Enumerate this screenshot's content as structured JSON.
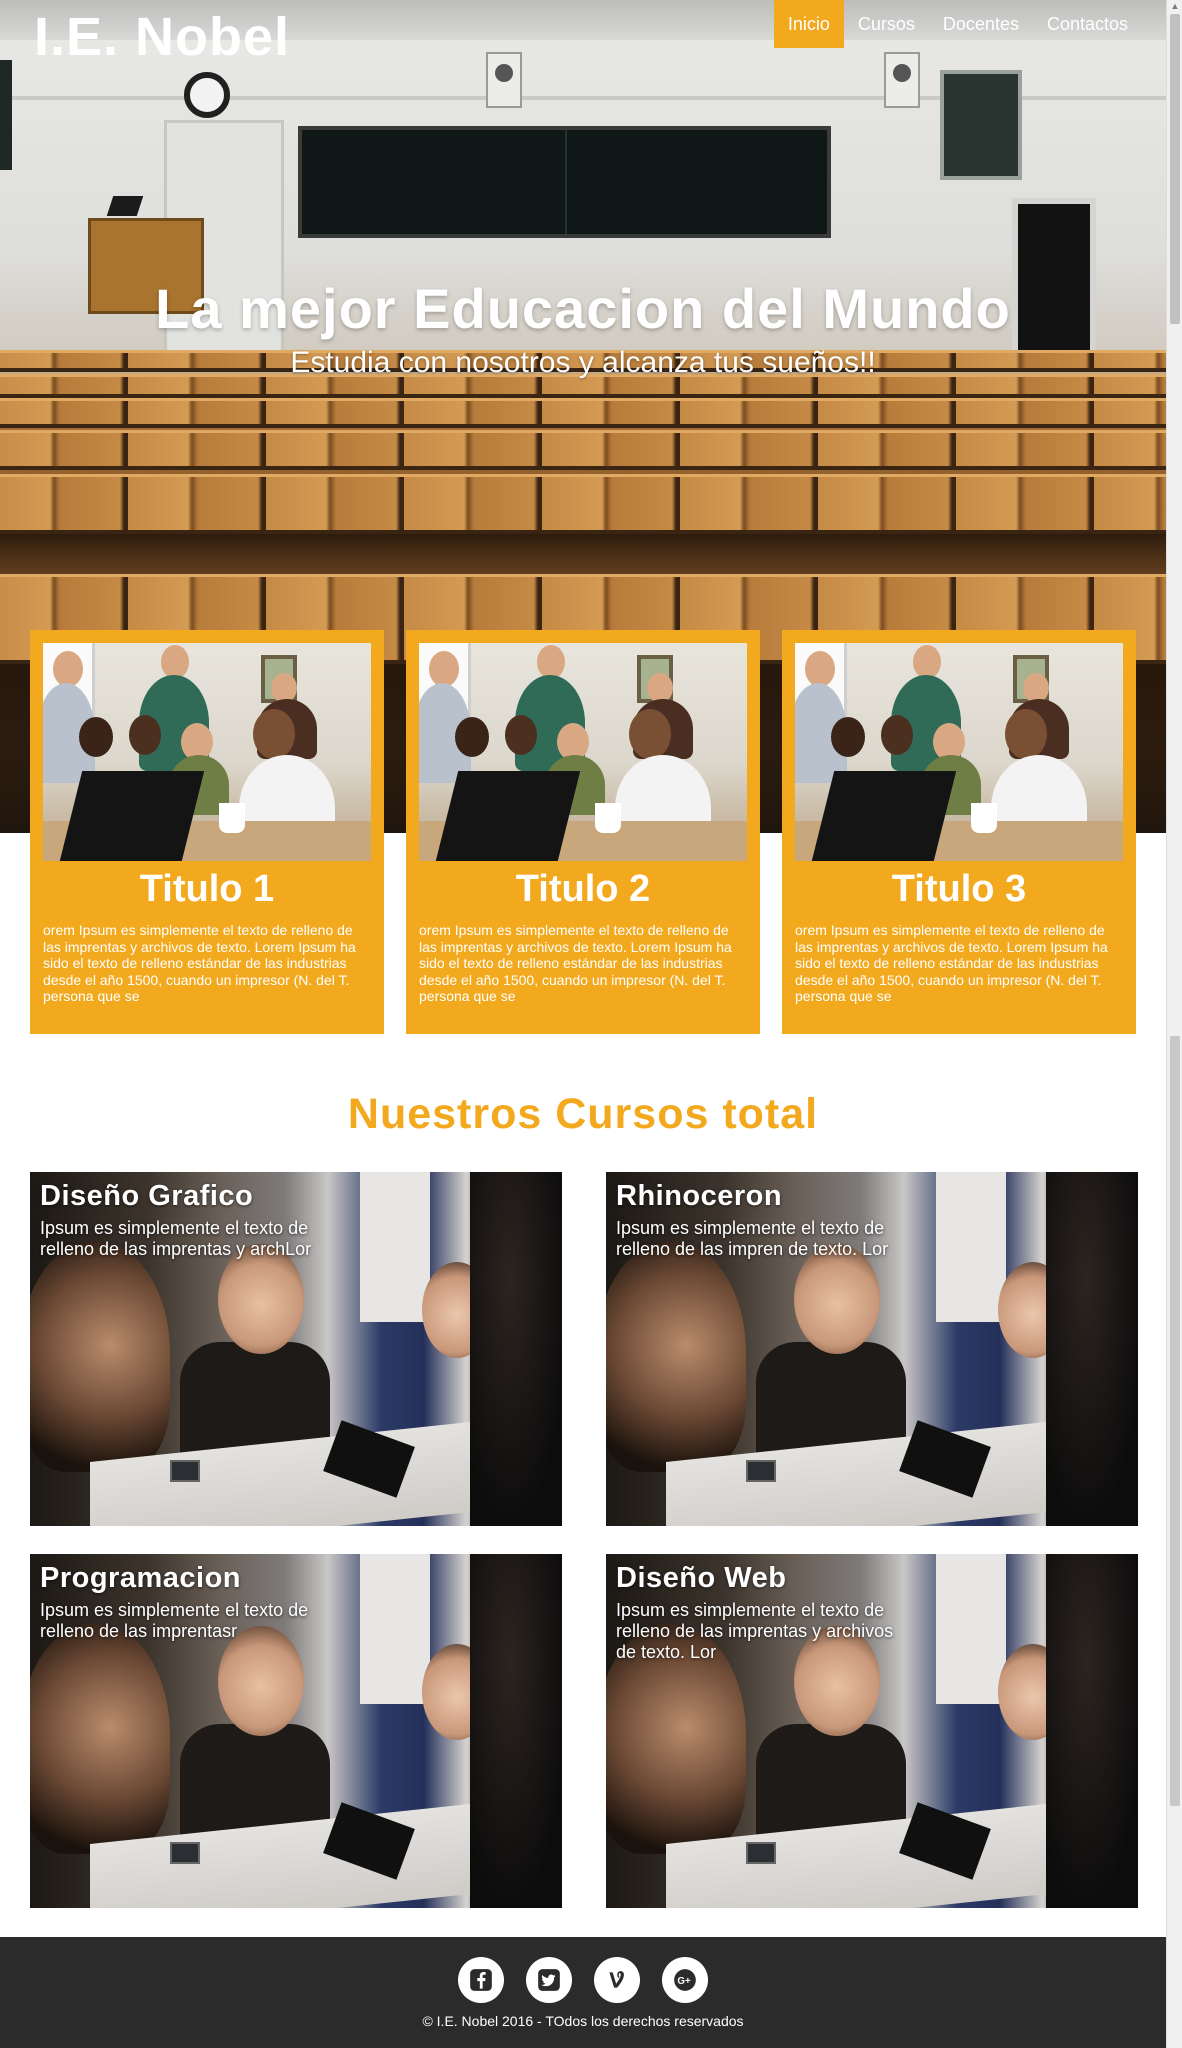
{
  "brand": "I.E. Nobel",
  "nav": {
    "items": [
      {
        "label": "Inicio",
        "active": true
      },
      {
        "label": "Cursos",
        "active": false
      },
      {
        "label": "Docentes",
        "active": false
      },
      {
        "label": "Contactos",
        "active": false
      }
    ]
  },
  "hero": {
    "title": "La mejor Educacion del Mundo",
    "subtitle": "Estudia con nosotros y alcanza tus sueños!!"
  },
  "features": [
    {
      "title": "Titulo 1",
      "text": "orem Ipsum es simplemente el texto de relleno de las imprentas y archivos de texto. Lorem Ipsum ha sido el texto de relleno estándar de las industrias desde el año 1500, cuando un impresor (N. del T. persona que se"
    },
    {
      "title": "Titulo 2",
      "text": "orem Ipsum es simplemente el texto de relleno de las imprentas y archivos de texto. Lorem Ipsum ha sido el texto de relleno estándar de las industrias desde el año 1500, cuando un impresor (N. del T. persona que se"
    },
    {
      "title": "Titulo 3",
      "text": "orem Ipsum es simplemente el texto de relleno de las imprentas y archivos de texto. Lorem Ipsum ha sido el texto de relleno estándar de las industrias desde el año 1500, cuando un impresor (N. del T. persona que se"
    }
  ],
  "courses": {
    "title": "Nuestros Cursos total",
    "items": [
      {
        "name": "Diseño Grafico",
        "desc": "Ipsum es simplemente el texto de relleno de las imprentas y archLor"
      },
      {
        "name": "Rhinoceron",
        "desc": "Ipsum es simplemente el texto de relleno de las impren de texto. Lor"
      },
      {
        "name": "Programacion",
        "desc": "Ipsum es simplemente el texto de relleno de las imprentasr"
      },
      {
        "name": "Diseño Web",
        "desc": "Ipsum es simplemente el texto de relleno de las imprentas y archivos de texto. Lor"
      }
    ]
  },
  "footer": {
    "social": [
      {
        "name": "facebook",
        "icon": "facebook-icon"
      },
      {
        "name": "twitter",
        "icon": "twitter-icon"
      },
      {
        "name": "vine",
        "icon": "vine-icon"
      },
      {
        "name": "google-plus",
        "icon": "google-plus-icon"
      }
    ],
    "copyright": "© I.E. Nobel 2016 - TOdos los derechos reservados"
  },
  "colors": {
    "accent": "#f2a91e",
    "footer_bg": "#2b2b2b",
    "text_light": "#ffffff"
  }
}
